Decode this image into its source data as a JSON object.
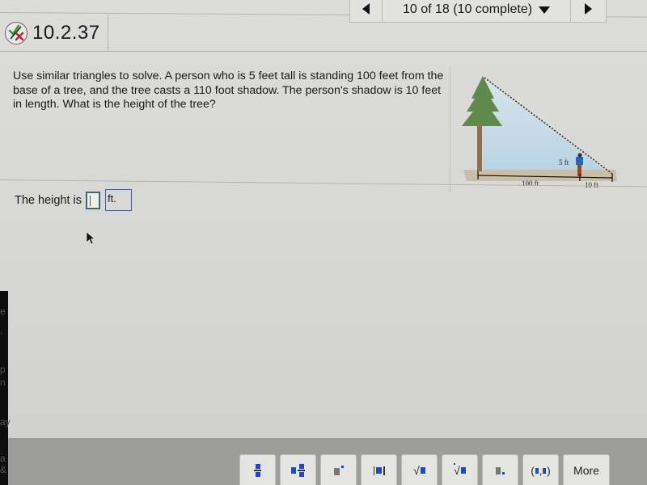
{
  "nav": {
    "prev_label": "previous question",
    "position_text": "10 of 18 (10 complete)",
    "next_label": "next question"
  },
  "question": {
    "number": "10.2.37",
    "status_icon": "partial-check-x-icon",
    "text": "Use similar triangles to solve.  A person who is 5 feet tall is standing 100 feet from the base of a tree, and the tree casts a 110 foot shadow.  The person's shadow is 10 feet in length.  What is the height of the tree?",
    "figure": {
      "person_height_label": "5 ft",
      "distance_label": "100 ft",
      "shadow_label": "10 ft"
    }
  },
  "answer": {
    "prefix": "The height is",
    "value": "",
    "unit": "ft."
  },
  "toolbar": {
    "buttons": [
      {
        "name": "fraction",
        "icon": "fraction-icon"
      },
      {
        "name": "mixed-number",
        "icon": "mixed-number-icon"
      },
      {
        "name": "exponent",
        "icon": "exponent-icon"
      },
      {
        "name": "absolute-value",
        "icon": "absolute-value-icon"
      },
      {
        "name": "square-root",
        "icon": "square-root-icon"
      },
      {
        "name": "nth-root",
        "icon": "nth-root-icon"
      },
      {
        "name": "decimal",
        "icon": "decimal-icon"
      },
      {
        "name": "ordered-pair",
        "icon": "ordered-pair-icon",
        "label": "(▪,▪)"
      },
      {
        "name": "more",
        "label": "More"
      }
    ]
  },
  "bezel": {
    "fragments": [
      "e",
      ".",
      "p",
      "n",
      "ay",
      "a &"
    ]
  }
}
